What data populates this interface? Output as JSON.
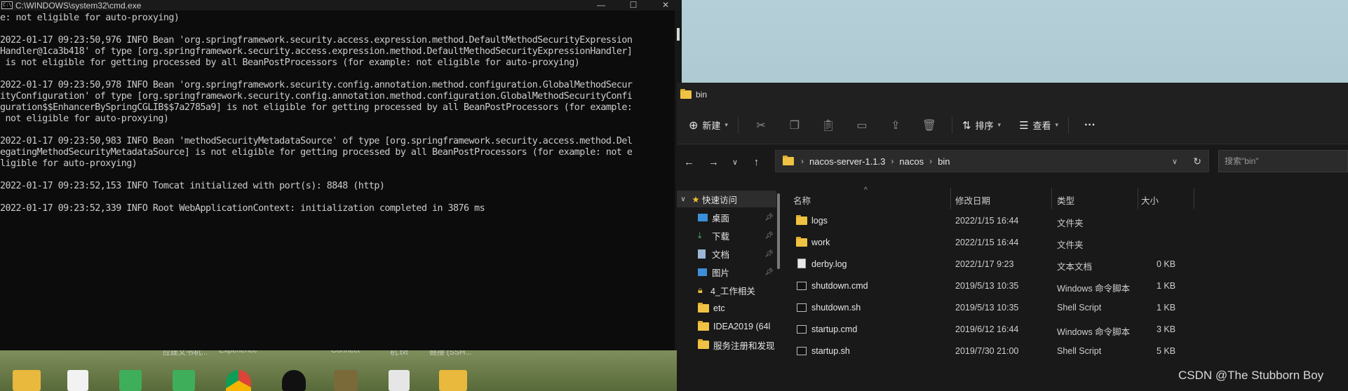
{
  "cmd": {
    "title": "C:\\WINDOWS\\system32\\cmd.exe",
    "controls": {
      "minimize": "—",
      "maximize": "☐",
      "close": "✕"
    },
    "lines": [
      "e: not eligible for auto-proxying)",
      "",
      "2022-01-17 09:23:50,976 INFO Bean 'org.springframework.security.access.expression.method.DefaultMethodSecurityExpression",
      "Handler@1ca3b418' of type [org.springframework.security.access.expression.method.DefaultMethodSecurityExpressionHandler]",
      " is not eligible for getting processed by all BeanPostProcessors (for example: not eligible for auto-proxying)",
      "",
      "2022-01-17 09:23:50,978 INFO Bean 'org.springframework.security.config.annotation.method.configuration.GlobalMethodSecur",
      "ityConfiguration' of type [org.springframework.security.config.annotation.method.configuration.GlobalMethodSecurityConfi",
      "guration$$EnhancerBySpringCGLIB$$7a2785a9] is not eligible for getting processed by all BeanPostProcessors (for example:",
      " not eligible for auto-proxying)",
      "",
      "2022-01-17 09:23:50,983 INFO Bean 'methodSecurityMetadataSource' of type [org.springframework.security.access.method.Del",
      "egatingMethodSecurityMetadataSource] is not eligible for getting processed by all BeanPostProcessors (for example: not e",
      "ligible for auto-proxying)",
      "",
      "2022-01-17 09:23:52,153 INFO Tomcat initialized with port(s): 8848 (http)",
      "",
      "2022-01-17 09:23:52,339 INFO Root WebApplicationContext: initialization completed in 3876 ms"
    ]
  },
  "desktop": {
    "labels": [
      "应建文书机...",
      "Experience",
      "Connect",
      "机.txt",
      "链接 (SSH..."
    ]
  },
  "explorer": {
    "title": "bin",
    "toolbar": {
      "new_label": "新建",
      "sort_label": "排序",
      "view_label": "查看",
      "more": "···"
    },
    "breadcrumb": [
      "nacos-server-1.1.3",
      "nacos",
      "bin"
    ],
    "search_placeholder": "搜索\"bin\"",
    "nav": [
      {
        "label": "快速访问",
        "icon": "star-icon"
      },
      {
        "label": "桌面",
        "icon": "desktop-icon",
        "pinned": true
      },
      {
        "label": "下载",
        "icon": "download-icon",
        "pinned": true
      },
      {
        "label": "文档",
        "icon": "document-icon",
        "pinned": true
      },
      {
        "label": "图片",
        "icon": "picture-icon",
        "pinned": true
      },
      {
        "label": "4_工作相关",
        "icon": "lock-folder-icon"
      },
      {
        "label": "etc",
        "icon": "folder-icon"
      },
      {
        "label": "IDEA2019 (64l",
        "icon": "folder-icon"
      },
      {
        "label": "服务注册和发现",
        "icon": "folder-icon"
      }
    ],
    "columns": {
      "name": "名称",
      "modified": "修改日期",
      "type": "类型",
      "size": "大小"
    },
    "files": [
      {
        "name": "logs",
        "modified": "2022/1/15 16:44",
        "type": "文件夹",
        "size": "",
        "icon": "folder-icon"
      },
      {
        "name": "work",
        "modified": "2022/1/15 16:44",
        "type": "文件夹",
        "size": "",
        "icon": "folder-icon"
      },
      {
        "name": "derby.log",
        "modified": "2022/1/17 9:23",
        "type": "文本文档",
        "size": "0 KB",
        "icon": "text-file-icon"
      },
      {
        "name": "shutdown.cmd",
        "modified": "2019/5/13 10:35",
        "type": "Windows 命令脚本",
        "size": "1 KB",
        "icon": "script-file-icon"
      },
      {
        "name": "shutdown.sh",
        "modified": "2019/5/13 10:35",
        "type": "Shell Script",
        "size": "1 KB",
        "icon": "script-file-icon"
      },
      {
        "name": "startup.cmd",
        "modified": "2019/6/12 16:44",
        "type": "Windows 命令脚本",
        "size": "3 KB",
        "icon": "script-file-icon"
      },
      {
        "name": "startup.sh",
        "modified": "2019/7/30 21:00",
        "type": "Shell Script",
        "size": "5 KB",
        "icon": "script-file-icon"
      }
    ]
  },
  "watermark": "CSDN @The Stubborn Boy"
}
